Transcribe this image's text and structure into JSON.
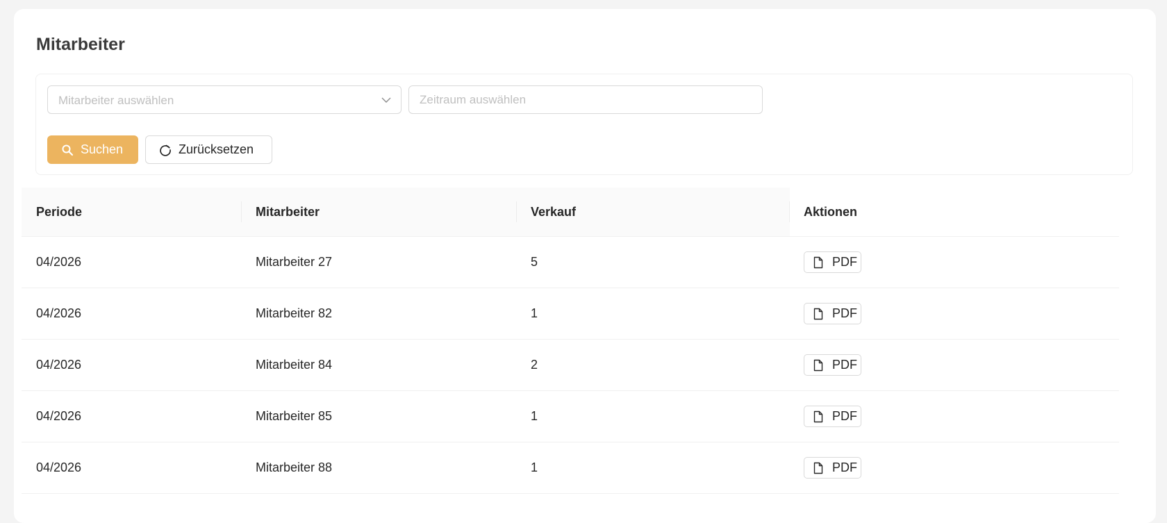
{
  "page": {
    "title": "Mitarbeiter"
  },
  "filters": {
    "employee_select_placeholder": "Mitarbeiter auswählen",
    "period_placeholder": "Zeitraum auswählen",
    "search_label": "Suchen",
    "reset_label": "Zurücksetzen"
  },
  "table": {
    "columns": [
      "Periode",
      "Mitarbeiter",
      "Verkauf",
      "Aktionen"
    ],
    "rows": [
      {
        "period": "04/2026",
        "employee": "Mitarbeiter 27",
        "sales": "5",
        "action": "PDF"
      },
      {
        "period": "04/2026",
        "employee": "Mitarbeiter 82",
        "sales": "1",
        "action": "PDF"
      },
      {
        "period": "04/2026",
        "employee": "Mitarbeiter 84",
        "sales": "2",
        "action": "PDF"
      },
      {
        "period": "04/2026",
        "employee": "Mitarbeiter 85",
        "sales": "1",
        "action": "PDF"
      },
      {
        "period": "04/2026",
        "employee": "Mitarbeiter 88",
        "sales": "1",
        "action": "PDF"
      }
    ]
  },
  "icons": {
    "search": "search-icon",
    "reset": "reload-icon",
    "dropdown": "chevron-down-icon",
    "pdf": "file-icon"
  },
  "colors": {
    "accent": "#ecb45f",
    "background": "#f4f4f4",
    "card": "#ffffff",
    "header_bg": "#fafafa"
  }
}
